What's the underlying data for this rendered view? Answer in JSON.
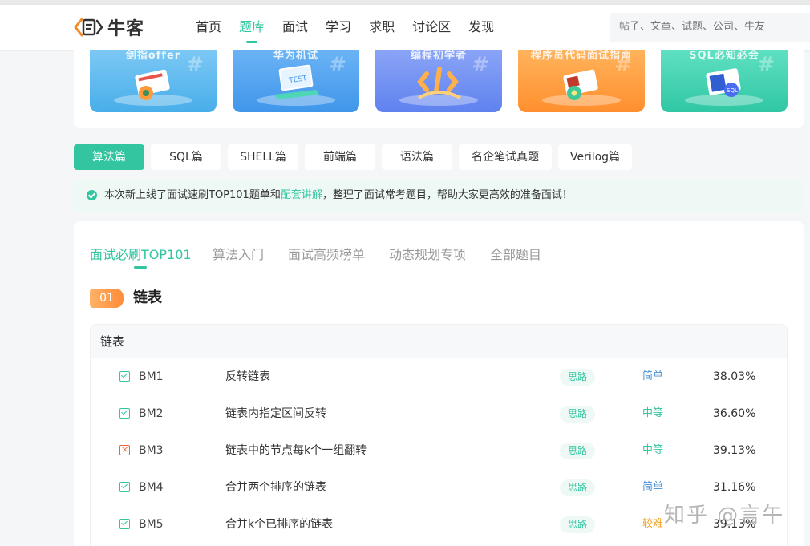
{
  "header": {
    "logo_text": "牛客",
    "nav": [
      "首页",
      "题库",
      "面试",
      "学习",
      "求职",
      "讨论区",
      "发现"
    ],
    "active_nav": "题库",
    "search_placeholder": "帖子、文章、试题、公司、牛友"
  },
  "banners": [
    {
      "title": "剑指offer",
      "color": "#5ab8f0"
    },
    {
      "title": "华为机试",
      "color": "#4aa2ef"
    },
    {
      "title": "编程初学者",
      "color": "#6c8ff2"
    },
    {
      "title": "程序员代码面试指南",
      "color": "#ff9c3e"
    },
    {
      "title": "SQL必知必会",
      "color": "#3fd1b0"
    }
  ],
  "categories": [
    "算法篇",
    "SQL篇",
    "SHELL篇",
    "前端篇",
    "语法篇",
    "名企笔试真题",
    "Verilog篇"
  ],
  "active_category": "算法篇",
  "notice": {
    "before": "本次新上线了面试速刷TOP101题单和",
    "link": "配套讲解",
    "after": "，整理了面试常考题目，帮助大家更高效的准备面试！"
  },
  "tabs": [
    "面试必刷TOP101",
    "算法入门",
    "面试高频榜单",
    "动态规划专项",
    "全部题目"
  ],
  "active_tab": "面试必刷TOP101",
  "section": {
    "number": "01",
    "title": "链表"
  },
  "table": {
    "header": "链表",
    "rows": [
      {
        "id": "BM1",
        "name": "反转链表",
        "tag": "思路",
        "difficulty": "简单",
        "diff_color": "#4a90d9",
        "rate": "38.03%",
        "status": "done"
      },
      {
        "id": "BM2",
        "name": "链表内指定区间反转",
        "tag": "思路",
        "difficulty": "中等",
        "diff_color": "#32c5a0",
        "rate": "36.60%",
        "status": "done"
      },
      {
        "id": "BM3",
        "name": "链表中的节点每k个一组翻转",
        "tag": "思路",
        "difficulty": "中等",
        "diff_color": "#32c5a0",
        "rate": "39.13%",
        "status": "error"
      },
      {
        "id": "BM4",
        "name": "合并两个排序的链表",
        "tag": "思路",
        "difficulty": "简单",
        "diff_color": "#4a90d9",
        "rate": "31.16%",
        "status": "done"
      },
      {
        "id": "BM5",
        "name": "合并k个已排序的链表",
        "tag": "思路",
        "difficulty": "较难",
        "diff_color": "#f0a020",
        "rate": "39.13%",
        "status": "done"
      }
    ]
  },
  "watermark": "知乎 @言午",
  "colors": {
    "accent": "#32c5a0",
    "orange": "#ff8c3a"
  }
}
